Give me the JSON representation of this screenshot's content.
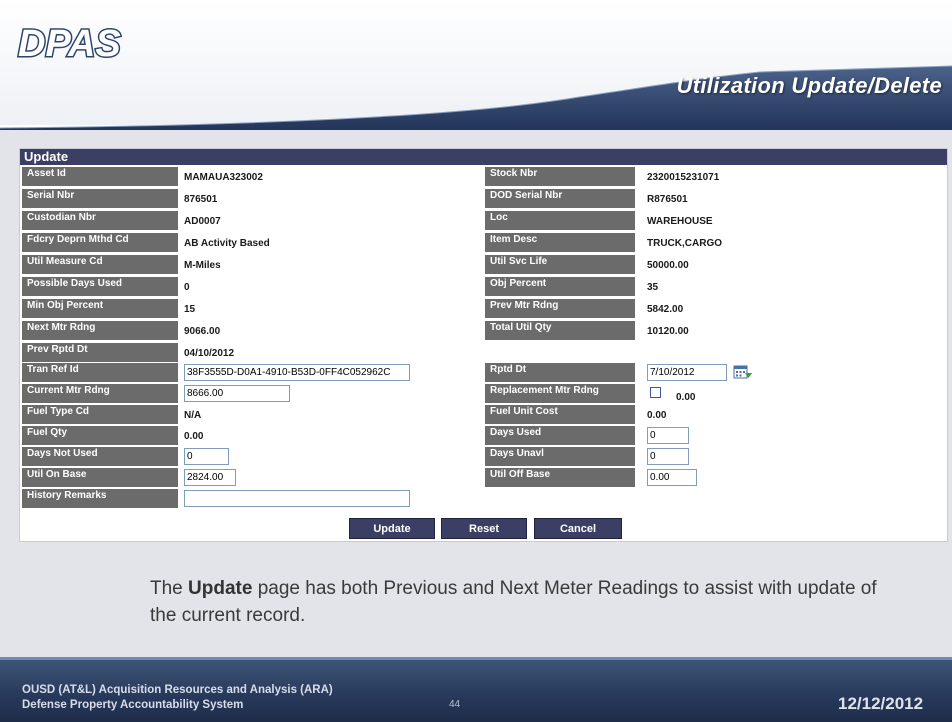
{
  "brand": {
    "logo_text": "DPAS"
  },
  "slide_title": "Utilization Update/Delete",
  "form": {
    "section_title": "Update",
    "rows": [
      {
        "left": {
          "label": "Asset Id",
          "value": "MAMAUA323002"
        },
        "right": {
          "label": "Stock Nbr",
          "value": "2320015231071"
        }
      },
      {
        "left": {
          "label": "Serial Nbr",
          "value": "876501"
        },
        "right": {
          "label": "DOD Serial Nbr",
          "value": "R876501"
        }
      },
      {
        "left": {
          "label": "Custodian Nbr",
          "value": "AD0007"
        },
        "right": {
          "label": "Loc",
          "value": "WAREHOUSE"
        }
      },
      {
        "left": {
          "label": "Fdcry Deprn Mthd Cd",
          "value": "AB Activity Based"
        },
        "right": {
          "label": "Item Desc",
          "value": "TRUCK,CARGO"
        }
      },
      {
        "left": {
          "label": "Util Measure Cd",
          "value": "M-Miles"
        },
        "right": {
          "label": "Util Svc Life",
          "value": "50000.00"
        }
      },
      {
        "left": {
          "label": "Possible Days Used",
          "value": "0"
        },
        "right": {
          "label": "Obj Percent",
          "value": "35"
        }
      },
      {
        "left": {
          "label": "Min Obj Percent",
          "value": "15"
        },
        "right": {
          "label": "Prev Mtr Rdng",
          "value": "5842.00"
        }
      },
      {
        "left": {
          "label": "Next Mtr Rdng",
          "value": "9066.00"
        },
        "right": {
          "label": "Total Util Qty",
          "value": "10120.00"
        }
      },
      {
        "left": {
          "label": "Prev Rptd Dt",
          "value": "04/10/2012"
        }
      }
    ],
    "tran_ref_id": {
      "label": "Tran Ref Id",
      "value": "38F3555D-D0A1-4910-B53D-0FF4C052962C"
    },
    "rptd_dt": {
      "label": "Rptd Dt",
      "value": "7/10/2012"
    },
    "current_mtr_rdng": {
      "label": "Current Mtr Rdng",
      "value": "8666.00"
    },
    "replacement_mtr_rdng": {
      "label": "Replacement Mtr Rdng",
      "checked": false,
      "value": "0.00"
    },
    "fuel_type_cd": {
      "label": "Fuel Type Cd",
      "value": "N/A"
    },
    "fuel_unit_cost": {
      "label": "Fuel Unit Cost",
      "value": "0.00"
    },
    "fuel_qty": {
      "label": "Fuel Qty",
      "value": "0.00"
    },
    "days_used": {
      "label": "Days Used",
      "value": "0"
    },
    "days_not_used": {
      "label": "Days Not Used",
      "value": "0"
    },
    "days_unavl": {
      "label": "Days Unavl",
      "value": "0"
    },
    "util_on_base": {
      "label": "Util On Base",
      "value": "2824.00"
    },
    "util_off_base": {
      "label": "Util Off Base",
      "value": "0.00"
    },
    "history_remarks": {
      "label": "History Remarks",
      "value": ""
    },
    "buttons": {
      "update": "Update",
      "reset": "Reset",
      "cancel": "Cancel"
    }
  },
  "caption": {
    "prefix": "The ",
    "bold": "Update",
    "suffix": " page has both Previous and Next Meter Readings to assist with update of the current record."
  },
  "footer": {
    "line1": "OUSD (AT&L) Acquisition Resources and Analysis (ARA)",
    "line2": "Defense Property Accountability System",
    "page_number": "44",
    "date": "12/12/2012"
  },
  "colors": {
    "header_bar": "#3b3f63",
    "label_bg": "#6b6b6b",
    "title_band": "#2a3d66",
    "footer_band": "#27385a"
  }
}
